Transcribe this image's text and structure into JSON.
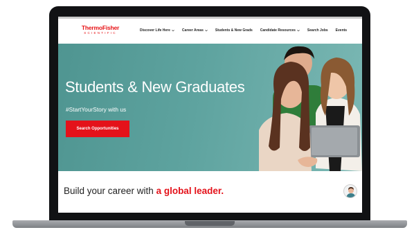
{
  "brand": {
    "logo_main": "ThermoFisher",
    "logo_sub": "SCIENTIFIC",
    "color": "#e71316"
  },
  "nav": {
    "items": [
      {
        "label": "Discover Life Here",
        "has_dropdown": true
      },
      {
        "label": "Career Areas",
        "has_dropdown": true
      },
      {
        "label": "Students & New Grads",
        "has_dropdown": false
      },
      {
        "label": "Candidate Resources",
        "has_dropdown": true
      },
      {
        "label": "Search Jobs",
        "has_dropdown": false
      },
      {
        "label": "Events",
        "has_dropdown": false
      }
    ]
  },
  "hero": {
    "title": "Students & New Graduates",
    "subtitle": "#StartYourStory with us",
    "cta_label": "Search Opportunities",
    "background": "#5ea39f",
    "cta_color": "#e4121a"
  },
  "section": {
    "tagline_prefix": "Build your career with ",
    "tagline_accent": "a global leader."
  },
  "icons": {
    "dropdown": "chevron-down-icon",
    "chat": "chat-avatar-icon"
  }
}
